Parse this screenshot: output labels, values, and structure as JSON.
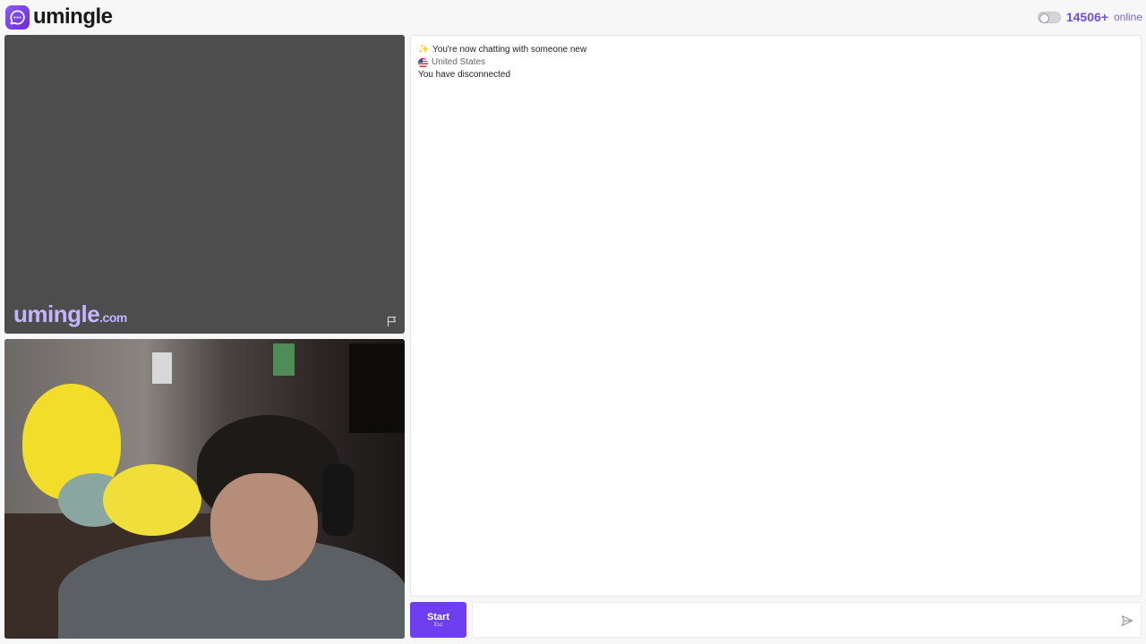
{
  "header": {
    "brand_name": "umingle",
    "online_count": "14506+",
    "online_label": "online"
  },
  "remote_video": {
    "watermark_name": "umingle",
    "watermark_tld": ".com"
  },
  "chat": {
    "messages": [
      {
        "type": "system",
        "icon": "sparkle-icon",
        "text": "You're now chatting with someone new"
      },
      {
        "type": "country",
        "icon": "us-flag-icon",
        "text": "United States"
      },
      {
        "type": "status",
        "text": "You have disconnected"
      }
    ]
  },
  "controls": {
    "start_label": "Start",
    "start_hint": "Esc",
    "message_placeholder": "",
    "message_value": ""
  },
  "colors": {
    "accent": "#6d3ff0",
    "brand_gradient_start": "#8b5cf6",
    "online_text": "#6d4fd8",
    "remote_video_bg": "#4d4d4d"
  }
}
